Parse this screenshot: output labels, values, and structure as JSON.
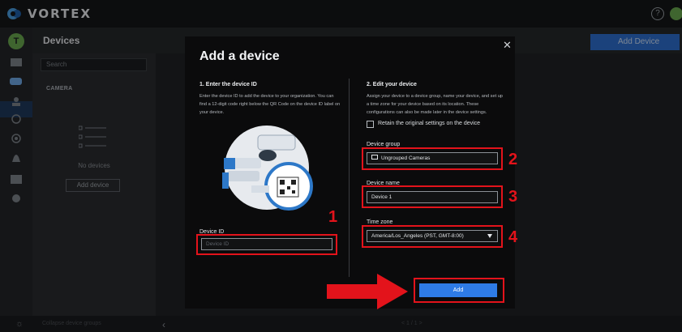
{
  "app": {
    "name": "VORTEX"
  },
  "header": {
    "help_icon": "help-icon",
    "page_title": "Devices",
    "add_device_label": "Add Device"
  },
  "nav_user_initial": "T",
  "left_panel": {
    "search_placeholder": "Search",
    "section_label": "CAMERA",
    "empty_text": "No devices",
    "add_device_label": "Add device"
  },
  "bottom": {
    "left_text": "Collapse device groups",
    "pager": "< 1 / 1 >"
  },
  "modal": {
    "title": "Add a device",
    "close_icon": "close-icon",
    "left": {
      "step_title": "1. Enter the device ID",
      "description": "Enter the device ID to add the device to your organization. You can find a 12-digit code right below the QR Code on the device ID label on your device.",
      "device_id_label": "Device ID",
      "device_id_placeholder": "Device ID"
    },
    "right": {
      "step_title": "2. Edit your device",
      "description": "Assign your device to a device group, name your device, and set up a time zone for your device based on its location. These configurations can also be made later in the device settings.",
      "retain_label": "Retain the original settings on the device",
      "retain_checked": false,
      "group_label": "Device group",
      "group_value": "Ungrouped Cameras",
      "name_label": "Device name",
      "name_value": "Device 1",
      "tz_label": "Time zone",
      "tz_value": "America/Los_Angeles (PST, GMT-8:00)"
    },
    "add_button_label": "Add"
  },
  "annotations": {
    "n1": "1",
    "n2": "2",
    "n3": "3",
    "n4": "4"
  },
  "colors": {
    "accent_blue": "#2e7be6",
    "annotation_red": "#e3131b",
    "modal_bg": "#0b0b0c",
    "green_avatar": "#6aa84f"
  }
}
